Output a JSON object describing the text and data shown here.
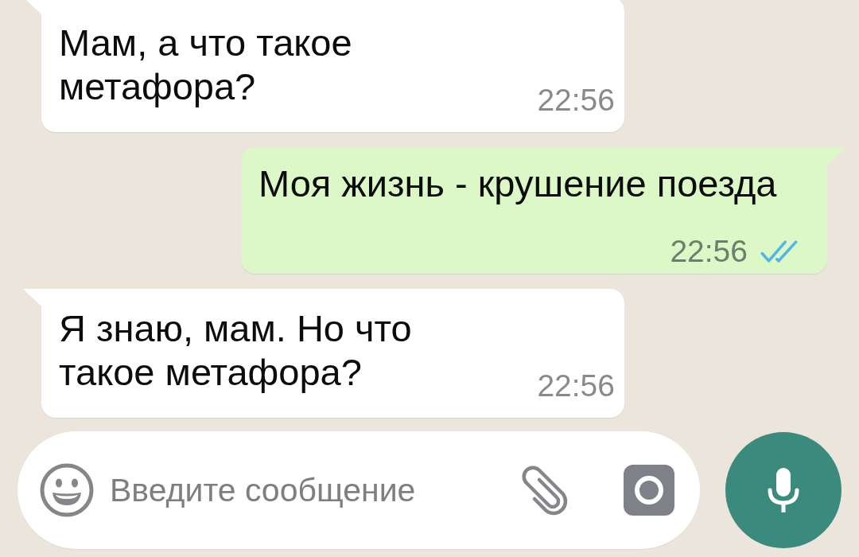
{
  "messages": [
    {
      "kind": "incoming",
      "text": "Мам, а что такое метафора?",
      "time": "22:56"
    },
    {
      "kind": "outgoing",
      "text": "Моя жизнь - крушение поезда",
      "time": "22:56",
      "read": true
    },
    {
      "kind": "incoming",
      "text": "Я знаю, мам. Но что такое метафора?",
      "time": "22:56"
    }
  ],
  "composer": {
    "placeholder": "Введите сообщение"
  }
}
